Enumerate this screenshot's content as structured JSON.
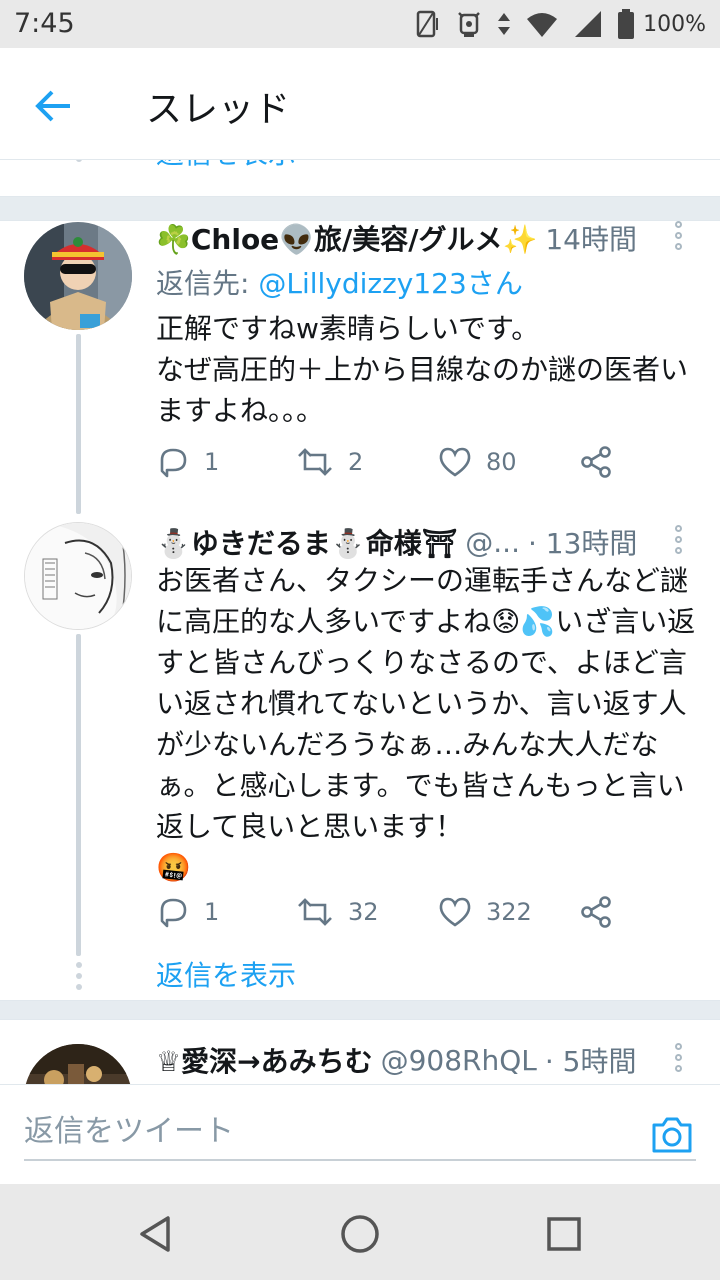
{
  "status_bar": {
    "time": "7:45",
    "battery_text": "100%",
    "icons": [
      "vibrate-icon",
      "alarm-icon",
      "data-arrows-icon",
      "wifi-icon",
      "signal-icon",
      "battery-icon"
    ]
  },
  "header": {
    "title": "スレッド",
    "back_icon": "arrow-left-icon"
  },
  "thread": {
    "prev_show_replies": "返信を表示",
    "tweets": [
      {
        "name": "☘️Chloe👽旅/美容/グルメ✨",
        "handle": "",
        "time": "14時間",
        "reply_prefix": "返信先: ",
        "reply_to": "@Lillydizzy123さん",
        "text": "正解ですねw素晴らしいです。\nなぜ高圧的＋上から目線なのか謎の医者いますよね。。。",
        "replies": "1",
        "retweets": "2",
        "likes": "80"
      },
      {
        "name": "⛄ゆきだるま⛄命様⛩",
        "handle": "@...",
        "time": "· 13時間",
        "text": "お医者さん、タクシーの運転手さんなど謎に高圧的な人多いですよね😟💦いざ言い返すと皆さんびっくりなさるので、よほど言い返され慣れてないというか、言い返す人が少ないんだろうなぁ…みんな大人だなぁ。と感心します。でも皆さんもっと言い返して良いと思います！\n🤬",
        "replies": "1",
        "retweets": "32",
        "likes": "322",
        "show_replies": "返信を表示"
      },
      {
        "name": "♕愛深→あみちむ",
        "handle": "@908RhQL",
        "time": "· 5時間"
      }
    ]
  },
  "composer": {
    "placeholder": "返信をツイート",
    "camera_icon": "camera-icon"
  },
  "navbar": {
    "buttons": [
      "back-triangle-icon",
      "home-circle-icon",
      "recents-square-icon"
    ]
  },
  "colors": {
    "accent": "#1da1f2",
    "secondary_text": "#657786",
    "separator": "#e6ecf0"
  }
}
